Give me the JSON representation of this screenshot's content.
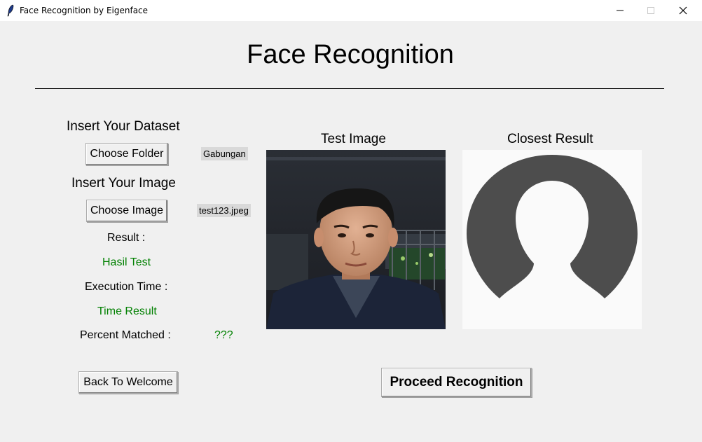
{
  "window": {
    "title": "Face Recognition by Eigenface",
    "controls": {
      "minimize": "minimize-icon",
      "maximize": "maximize-icon",
      "close": "close-icon"
    }
  },
  "header": {
    "title": "Face Recognition"
  },
  "left_panel": {
    "dataset_heading": "Insert Your Dataset",
    "choose_folder_label": "Choose Folder",
    "folder_value": "Gabungan",
    "image_heading": "Insert Your Image",
    "choose_image_label": "Choose Image",
    "image_value": "test123.jpeg",
    "result_label": "Result :",
    "result_value": "Hasil Test",
    "exec_time_label": "Execution Time :",
    "exec_time_value": "Time Result",
    "percent_label": "Percent Matched :",
    "percent_value": "???",
    "back_label": "Back To Welcome"
  },
  "images": {
    "test_title": "Test Image",
    "closest_title": "Closest Result"
  },
  "actions": {
    "proceed_label": "Proceed Recognition"
  },
  "colors": {
    "result_text": "#008000",
    "background": "#f0f0f0",
    "placeholder_avatar": "#4d4d4d"
  }
}
